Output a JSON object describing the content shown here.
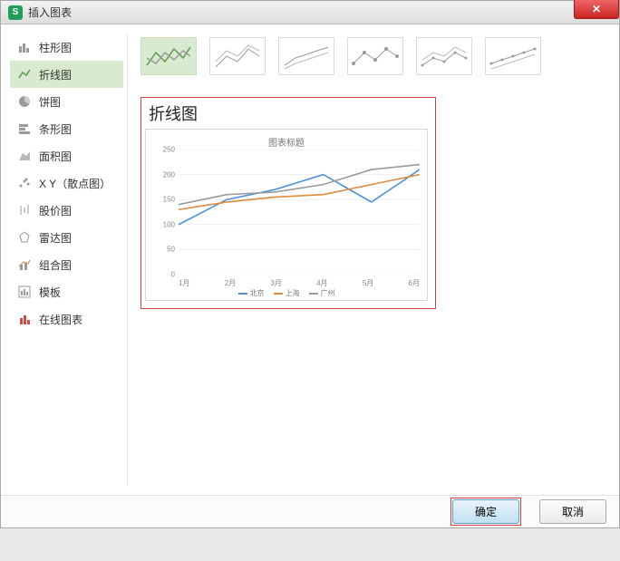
{
  "window": {
    "title": "插入图表",
    "close_tooltip": "关闭"
  },
  "sidebar": {
    "items": [
      {
        "label": "柱形图",
        "icon": "bar"
      },
      {
        "label": "折线图",
        "icon": "line",
        "selected": true
      },
      {
        "label": "饼图",
        "icon": "pie"
      },
      {
        "label": "条形图",
        "icon": "hbar"
      },
      {
        "label": "面积图",
        "icon": "area"
      },
      {
        "label": "X Y（散点图）",
        "icon": "scatter"
      },
      {
        "label": "股价图",
        "icon": "stock"
      },
      {
        "label": "雷达图",
        "icon": "radar"
      },
      {
        "label": "组合图",
        "icon": "combo"
      },
      {
        "label": "模板",
        "icon": "template"
      },
      {
        "label": "在线图表",
        "icon": "online"
      }
    ]
  },
  "subtype_selected_index": 0,
  "preview": {
    "heading": "折线图"
  },
  "chart_data": {
    "type": "line",
    "title": "图表标题",
    "xlabel": "",
    "ylabel": "",
    "ylim": [
      0,
      250
    ],
    "y_ticks": [
      0,
      50,
      100,
      150,
      200,
      250
    ],
    "categories": [
      "1月",
      "2月",
      "3月",
      "4月",
      "5月",
      "6月"
    ],
    "series": [
      {
        "name": "北京",
        "color": "#4a90d9",
        "values": [
          100,
          150,
          170,
          200,
          145,
          210
        ]
      },
      {
        "name": "上海",
        "color": "#e08a3c",
        "values": [
          130,
          145,
          155,
          160,
          180,
          200
        ]
      },
      {
        "name": "广州",
        "color": "#9a9a9a",
        "values": [
          140,
          160,
          165,
          180,
          210,
          220
        ]
      }
    ]
  },
  "footer": {
    "ok_label": "确定",
    "cancel_label": "取消"
  }
}
